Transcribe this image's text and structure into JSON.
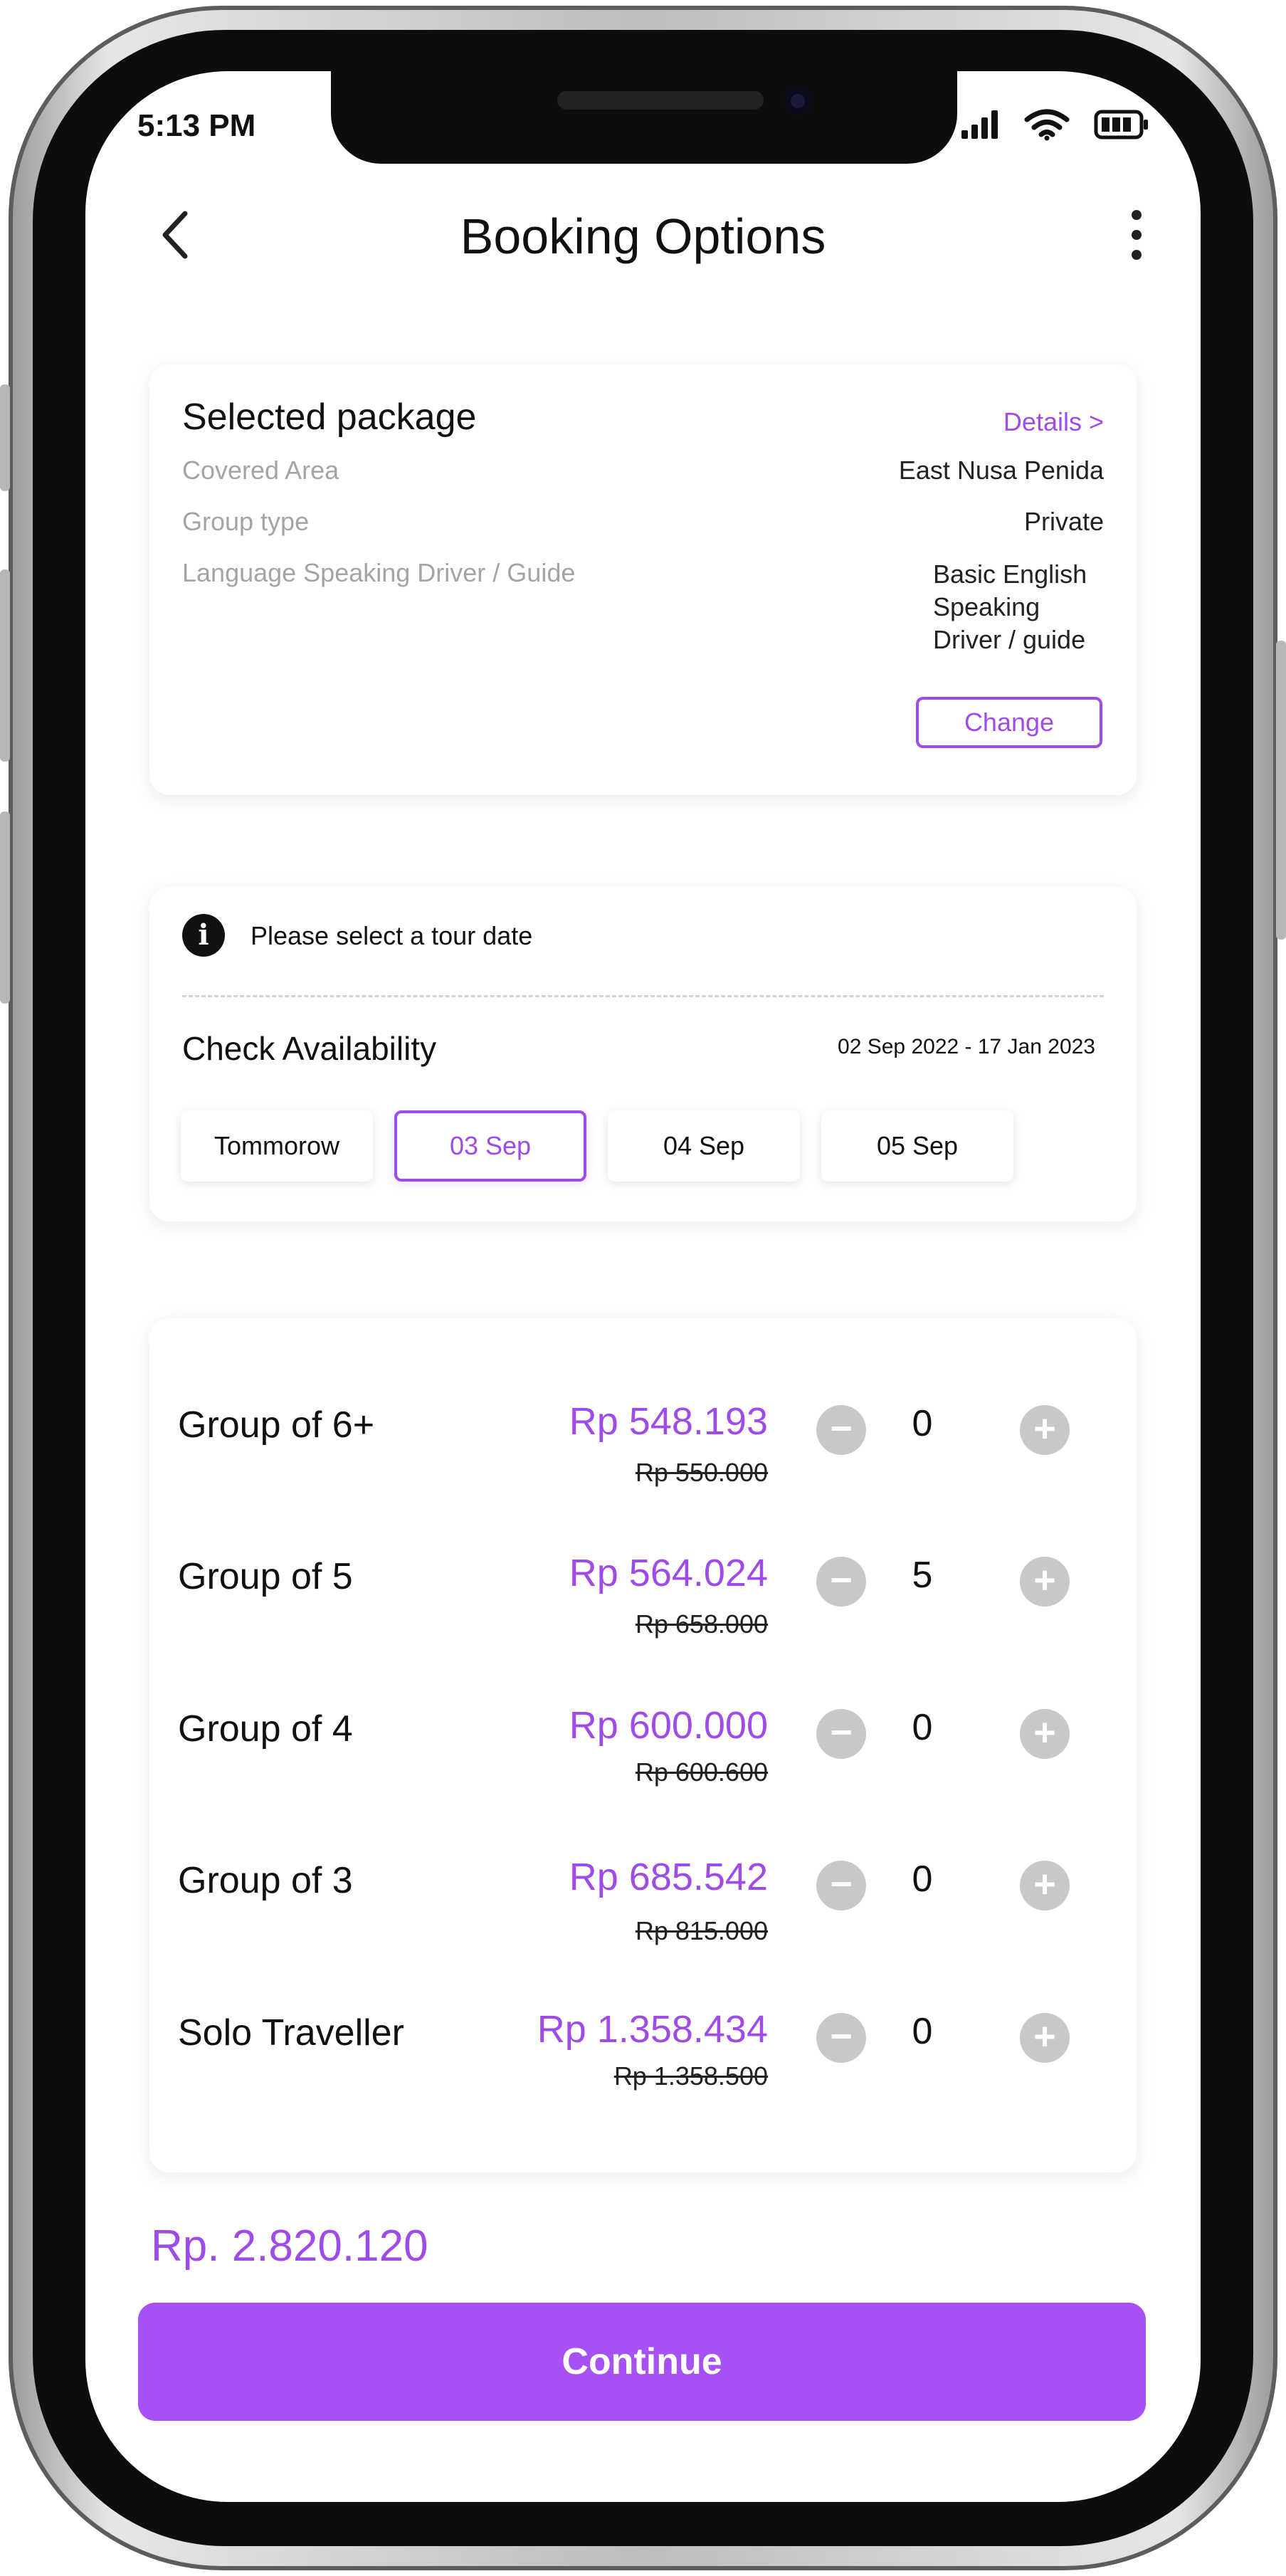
{
  "status": {
    "time": "5:13 PM"
  },
  "header": {
    "title": "Booking Options"
  },
  "package": {
    "title": "Selected package",
    "details_link": "Details >",
    "rows": [
      {
        "label": "Covered Area",
        "value": "East Nusa Penida"
      },
      {
        "label": "Group type",
        "value": "Private"
      },
      {
        "label": "Language Speaking Driver / Guide",
        "value_lines": [
          "Basic English",
          "Speaking",
          "Driver / guide"
        ]
      }
    ],
    "change_label": "Change"
  },
  "availability": {
    "info_text": "Please select a tour date",
    "title": "Check Availability",
    "range": "02 Sep 2022 - 17 Jan 2023",
    "dates": [
      "Tommorow",
      "03 Sep",
      "04 Sep",
      "05 Sep"
    ],
    "selected_index": 1
  },
  "groups": [
    {
      "label": "Group of 6+",
      "price": "Rp 548.193",
      "old_price": "Rp 550.000",
      "qty": "0"
    },
    {
      "label": "Group of 5",
      "price": "Rp 564.024",
      "old_price": "Rp 658.000",
      "qty": "5"
    },
    {
      "label": "Group of 4",
      "price": "Rp 600.000",
      "old_price": "Rp 600.600",
      "qty": "0"
    },
    {
      "label": "Group of 3",
      "price": "Rp 685.542",
      "old_price": "Rp 815.000",
      "qty": "0"
    },
    {
      "label": "Solo Traveller",
      "price": "Rp 1.358.434",
      "old_price": "Rp 1.358.500",
      "qty": "0"
    }
  ],
  "total": "Rp. 2.820.120",
  "continue_label": "Continue",
  "colors": {
    "accent": "#9f4be8",
    "button": "#a651f4",
    "qty_button": "#c8c8c8"
  }
}
